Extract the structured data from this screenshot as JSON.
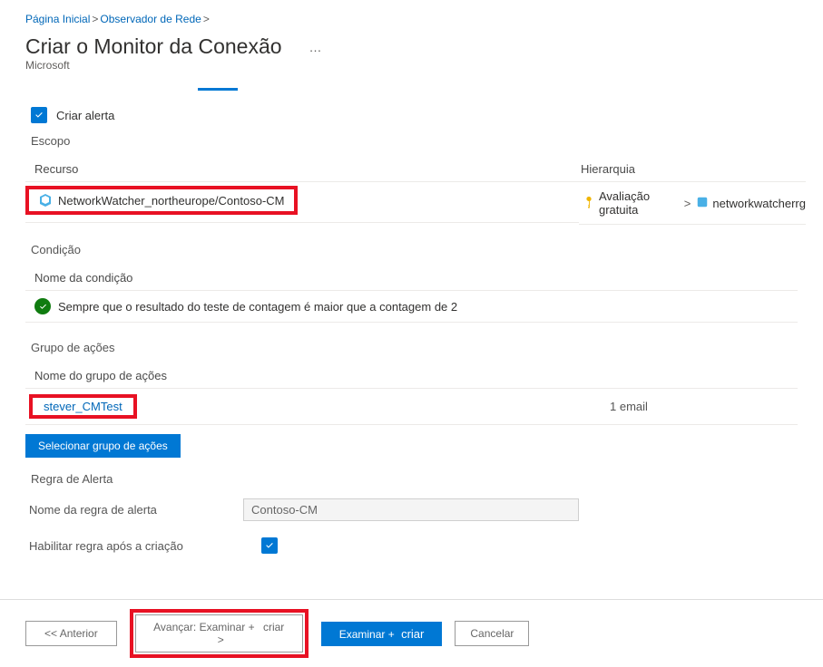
{
  "breadcrumb": {
    "home": "Página Inicial",
    "watcher": "Observador de Rede"
  },
  "header": {
    "title": "Criar o Monitor da Conexão",
    "subtitle": "Microsoft",
    "dots": "…"
  },
  "alert": {
    "create_label": "Criar alerta",
    "scope_label": "Escopo"
  },
  "resource": {
    "col_title": "Recurso",
    "row_text": "NetworkWatcher_northeurope/Contoso-CM"
  },
  "hierarchy": {
    "col_title": "Hierarquia",
    "trial": "Avaliação gratuita",
    "rg": "networkwatcherrg"
  },
  "condition": {
    "section_label": "Condição",
    "col_title": "Nome da condição",
    "text": "Sempre que o resultado do teste de contagem é maior que a contagem de 2"
  },
  "action_group": {
    "section_label": "Grupo de ações",
    "col_title": "Nome do grupo de ações",
    "name": "stever_CMTest",
    "contains": "1 email",
    "select_btn": "Selecionar grupo de ações"
  },
  "rule": {
    "section_label": "Regra de Alerta",
    "name_label": "Nome da regra de alerta",
    "name_value": "Contoso-CM",
    "enable_label": "Habilitar regra após a criação"
  },
  "footer": {
    "prev": "<<  Anterior",
    "next_combined": "Avançar: Examinar + criar >",
    "next_a": "Avançar:",
    "next_b": "Examinar +",
    "next_c": "criar",
    "next_d": ">",
    "review": "Examinar + criar",
    "review_a": "Examinar +",
    "review_b": "criar",
    "cancel": "Cancelar"
  }
}
